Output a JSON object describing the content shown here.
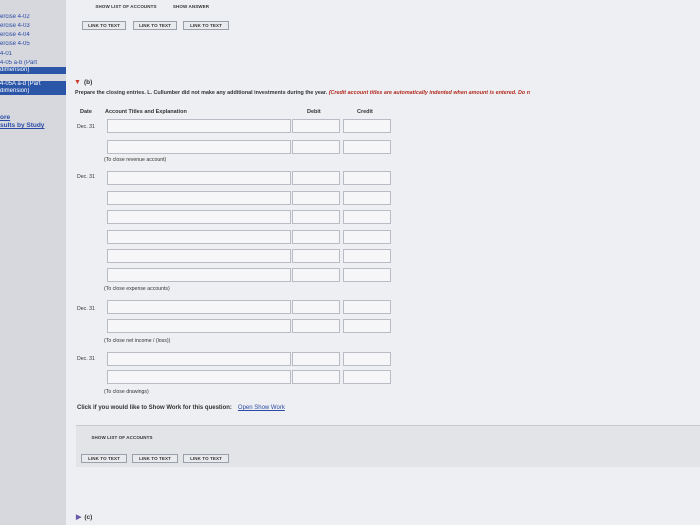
{
  "sidebar": {
    "items": [
      {
        "label": "ercise 4-02",
        "active": false
      },
      {
        "label": "ercise 4-03",
        "active": false
      },
      {
        "label": "ercise 4-04",
        "active": false
      },
      {
        "label": "ercise 4-05",
        "active": false
      },
      {
        "label": "4-01",
        "active": false
      },
      {
        "label": "4-05 a-b (Part",
        "active": false
      },
      {
        "label": "dimension)",
        "active": true
      },
      {
        "label": "4-05A a-d (Part",
        "active": true
      },
      {
        "label": "dimension)",
        "active": true
      }
    ],
    "study_link_pre": "ore",
    "study_link": "sults by Study"
  },
  "top_toolbar": {
    "show_list_label": "SHOW LIST OF ACCOUNTS",
    "show_answer_label": "SHOW ANSWER",
    "link_to_text_1": "LINK TO TEXT",
    "link_to_text_2": "LINK TO TEXT",
    "link_to_text_3": "LINK TO TEXT"
  },
  "part_b": {
    "label": "(b)",
    "instructions": "Prepare the closing entries. L. Cullumber did not make any additional investments during the year.",
    "note": "(Credit account titles are automatically indented when amount is entered. Do n"
  },
  "table": {
    "col_date": "Date",
    "col_account": "Account Titles and Explanation",
    "col_debit": "Debit",
    "col_credit": "Credit"
  },
  "entries": [
    {
      "date": "Dec. 31",
      "caption": "(To close revenue account)"
    },
    {
      "date": "Dec. 31",
      "caption": "(To close expense accounts)"
    },
    {
      "date": "Dec. 31",
      "caption": "(To close net income / (loss))"
    },
    {
      "date": "Dec. 31",
      "caption": "(To close drawings)"
    }
  ],
  "show_work": {
    "prompt": "Click if you would like to Show Work for this question:",
    "link": "Open Show Work"
  },
  "bottom_toolbar": {
    "show_list_label": "SHOW LIST OF ACCOUNTS",
    "link_to_text_1": "LINK TO TEXT",
    "link_to_text_2": "LINK TO TEXT",
    "link_to_text_3": "LINK TO TEXT"
  },
  "part_c": {
    "label": "(c)"
  }
}
